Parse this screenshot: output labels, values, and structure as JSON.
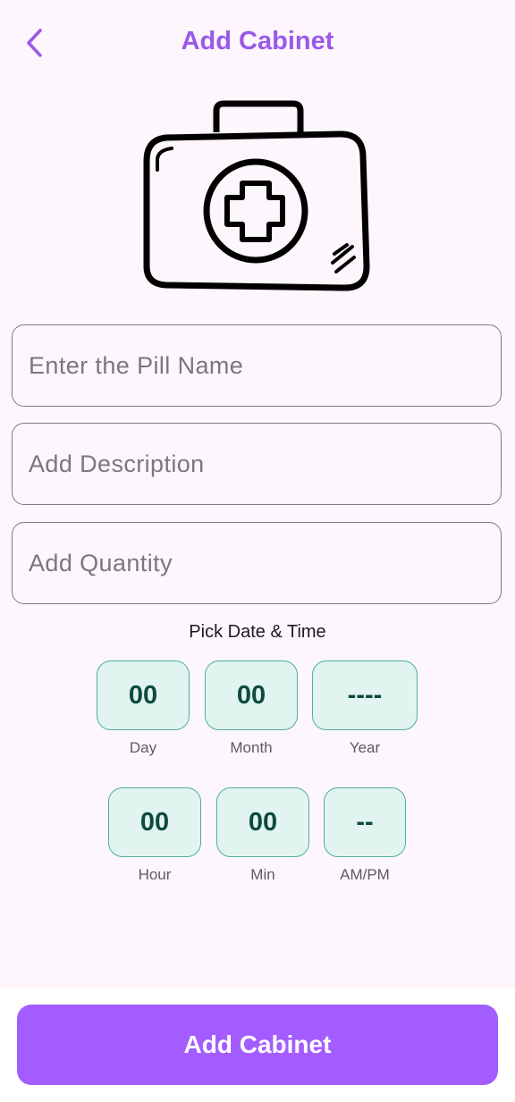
{
  "header": {
    "title": "Add Cabinet",
    "back_icon": "chevron-left-icon"
  },
  "illustration": {
    "icon": "first-aid-kit-icon"
  },
  "form": {
    "pill_name_placeholder": "Enter the Pill Name",
    "description_placeholder": "Add Description",
    "quantity_placeholder": "Add Quantity"
  },
  "datetime": {
    "label": "Pick Date & Time",
    "date": [
      {
        "value": "00",
        "caption": "Day"
      },
      {
        "value": "00",
        "caption": "Month"
      },
      {
        "value": "----",
        "caption": "Year"
      }
    ],
    "time": [
      {
        "value": "00",
        "caption": "Hour"
      },
      {
        "value": "00",
        "caption": "Min"
      },
      {
        "value": "--",
        "caption": "AM/PM"
      }
    ]
  },
  "footer": {
    "button_label": "Add Cabinet"
  },
  "colors": {
    "accent": "#9b59e8",
    "button": "#a35cff",
    "box_fill": "#e1f4f0",
    "box_border": "#4fb09a",
    "box_text": "#0d4a3f",
    "background": "#fdf6fd"
  }
}
